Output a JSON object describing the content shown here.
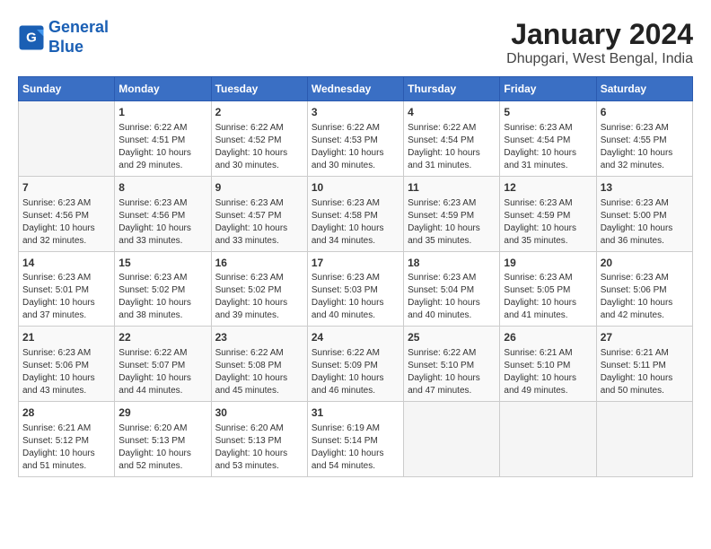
{
  "logo": {
    "line1": "General",
    "line2": "Blue"
  },
  "title": "January 2024",
  "subtitle": "Dhupgari, West Bengal, India",
  "days_of_week": [
    "Sunday",
    "Monday",
    "Tuesday",
    "Wednesday",
    "Thursday",
    "Friday",
    "Saturday"
  ],
  "weeks": [
    [
      {
        "day": "",
        "info": ""
      },
      {
        "day": "1",
        "info": "Sunrise: 6:22 AM\nSunset: 4:51 PM\nDaylight: 10 hours\nand 29 minutes."
      },
      {
        "day": "2",
        "info": "Sunrise: 6:22 AM\nSunset: 4:52 PM\nDaylight: 10 hours\nand 30 minutes."
      },
      {
        "day": "3",
        "info": "Sunrise: 6:22 AM\nSunset: 4:53 PM\nDaylight: 10 hours\nand 30 minutes."
      },
      {
        "day": "4",
        "info": "Sunrise: 6:22 AM\nSunset: 4:54 PM\nDaylight: 10 hours\nand 31 minutes."
      },
      {
        "day": "5",
        "info": "Sunrise: 6:23 AM\nSunset: 4:54 PM\nDaylight: 10 hours\nand 31 minutes."
      },
      {
        "day": "6",
        "info": "Sunrise: 6:23 AM\nSunset: 4:55 PM\nDaylight: 10 hours\nand 32 minutes."
      }
    ],
    [
      {
        "day": "7",
        "info": "Sunrise: 6:23 AM\nSunset: 4:56 PM\nDaylight: 10 hours\nand 32 minutes."
      },
      {
        "day": "8",
        "info": "Sunrise: 6:23 AM\nSunset: 4:56 PM\nDaylight: 10 hours\nand 33 minutes."
      },
      {
        "day": "9",
        "info": "Sunrise: 6:23 AM\nSunset: 4:57 PM\nDaylight: 10 hours\nand 33 minutes."
      },
      {
        "day": "10",
        "info": "Sunrise: 6:23 AM\nSunset: 4:58 PM\nDaylight: 10 hours\nand 34 minutes."
      },
      {
        "day": "11",
        "info": "Sunrise: 6:23 AM\nSunset: 4:59 PM\nDaylight: 10 hours\nand 35 minutes."
      },
      {
        "day": "12",
        "info": "Sunrise: 6:23 AM\nSunset: 4:59 PM\nDaylight: 10 hours\nand 35 minutes."
      },
      {
        "day": "13",
        "info": "Sunrise: 6:23 AM\nSunset: 5:00 PM\nDaylight: 10 hours\nand 36 minutes."
      }
    ],
    [
      {
        "day": "14",
        "info": "Sunrise: 6:23 AM\nSunset: 5:01 PM\nDaylight: 10 hours\nand 37 minutes."
      },
      {
        "day": "15",
        "info": "Sunrise: 6:23 AM\nSunset: 5:02 PM\nDaylight: 10 hours\nand 38 minutes."
      },
      {
        "day": "16",
        "info": "Sunrise: 6:23 AM\nSunset: 5:02 PM\nDaylight: 10 hours\nand 39 minutes."
      },
      {
        "day": "17",
        "info": "Sunrise: 6:23 AM\nSunset: 5:03 PM\nDaylight: 10 hours\nand 40 minutes."
      },
      {
        "day": "18",
        "info": "Sunrise: 6:23 AM\nSunset: 5:04 PM\nDaylight: 10 hours\nand 40 minutes."
      },
      {
        "day": "19",
        "info": "Sunrise: 6:23 AM\nSunset: 5:05 PM\nDaylight: 10 hours\nand 41 minutes."
      },
      {
        "day": "20",
        "info": "Sunrise: 6:23 AM\nSunset: 5:06 PM\nDaylight: 10 hours\nand 42 minutes."
      }
    ],
    [
      {
        "day": "21",
        "info": "Sunrise: 6:23 AM\nSunset: 5:06 PM\nDaylight: 10 hours\nand 43 minutes."
      },
      {
        "day": "22",
        "info": "Sunrise: 6:22 AM\nSunset: 5:07 PM\nDaylight: 10 hours\nand 44 minutes."
      },
      {
        "day": "23",
        "info": "Sunrise: 6:22 AM\nSunset: 5:08 PM\nDaylight: 10 hours\nand 45 minutes."
      },
      {
        "day": "24",
        "info": "Sunrise: 6:22 AM\nSunset: 5:09 PM\nDaylight: 10 hours\nand 46 minutes."
      },
      {
        "day": "25",
        "info": "Sunrise: 6:22 AM\nSunset: 5:10 PM\nDaylight: 10 hours\nand 47 minutes."
      },
      {
        "day": "26",
        "info": "Sunrise: 6:21 AM\nSunset: 5:10 PM\nDaylight: 10 hours\nand 49 minutes."
      },
      {
        "day": "27",
        "info": "Sunrise: 6:21 AM\nSunset: 5:11 PM\nDaylight: 10 hours\nand 50 minutes."
      }
    ],
    [
      {
        "day": "28",
        "info": "Sunrise: 6:21 AM\nSunset: 5:12 PM\nDaylight: 10 hours\nand 51 minutes."
      },
      {
        "day": "29",
        "info": "Sunrise: 6:20 AM\nSunset: 5:13 PM\nDaylight: 10 hours\nand 52 minutes."
      },
      {
        "day": "30",
        "info": "Sunrise: 6:20 AM\nSunset: 5:13 PM\nDaylight: 10 hours\nand 53 minutes."
      },
      {
        "day": "31",
        "info": "Sunrise: 6:19 AM\nSunset: 5:14 PM\nDaylight: 10 hours\nand 54 minutes."
      },
      {
        "day": "",
        "info": ""
      },
      {
        "day": "",
        "info": ""
      },
      {
        "day": "",
        "info": ""
      }
    ]
  ]
}
